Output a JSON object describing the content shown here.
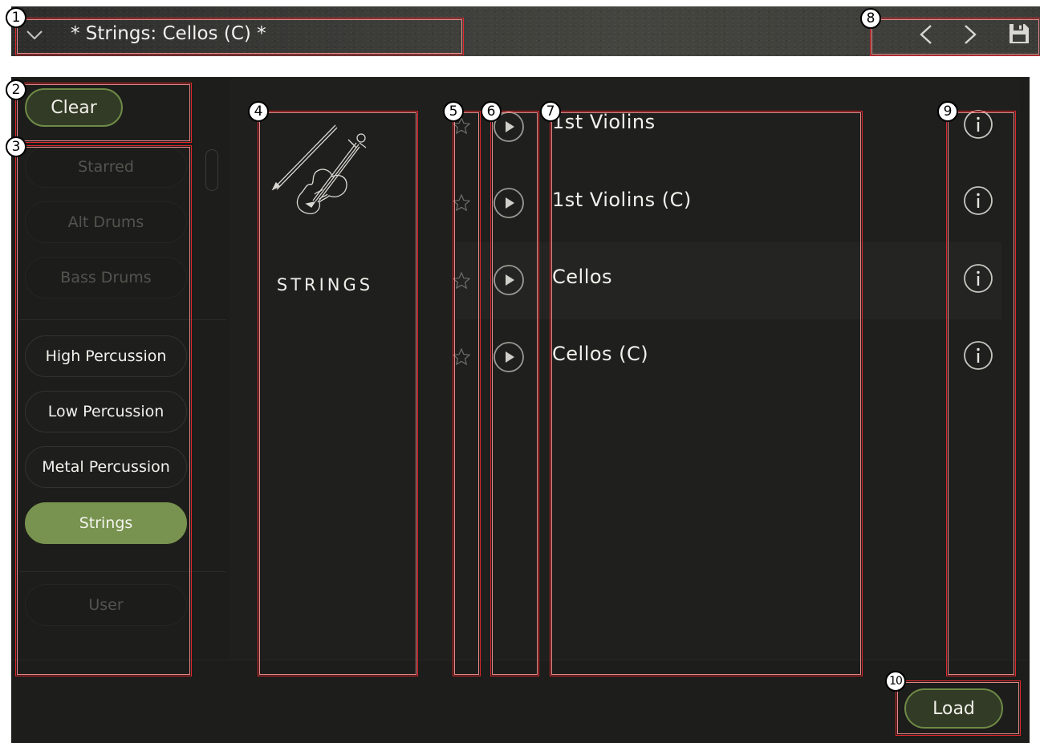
{
  "header": {
    "preset_name": "* Strings: Cellos (C) *",
    "icons": [
      "chevron-down-icon",
      "chevron-left-icon",
      "chevron-right-icon",
      "save-icon"
    ]
  },
  "sidebar": {
    "clear_label": "Clear",
    "categories": [
      {
        "label": "Starred",
        "state": "disabled"
      },
      {
        "label": "Alt Drums",
        "state": "disabled"
      },
      {
        "label": "Bass Drums",
        "state": "disabled"
      },
      {
        "label": "High Percussion",
        "state": "enabled"
      },
      {
        "label": "Low Percussion",
        "state": "enabled"
      },
      {
        "label": "Metal Percussion",
        "state": "enabled"
      },
      {
        "label": "Strings",
        "state": "selected"
      },
      {
        "label": "User",
        "state": "disabled"
      }
    ]
  },
  "category_panel": {
    "title": "STRINGS",
    "icon": "violin-icon"
  },
  "presets": [
    {
      "label": "1st Violins",
      "starred": false,
      "highlighted": false
    },
    {
      "label": "1st Violins (C)",
      "starred": false,
      "highlighted": false
    },
    {
      "label": "Cellos",
      "starred": false,
      "highlighted": true
    },
    {
      "label": "Cellos (C)",
      "starred": false,
      "highlighted": false
    }
  ],
  "footer": {
    "load_label": "Load"
  },
  "annotations": [
    "1",
    "2",
    "3",
    "4",
    "5",
    "6",
    "7",
    "8",
    "9",
    "10"
  ],
  "colors": {
    "accent": "#78924f",
    "accent_border": "#6e8a46",
    "panel_bg": "#1d1d1b",
    "annotation": "#e0262c"
  }
}
